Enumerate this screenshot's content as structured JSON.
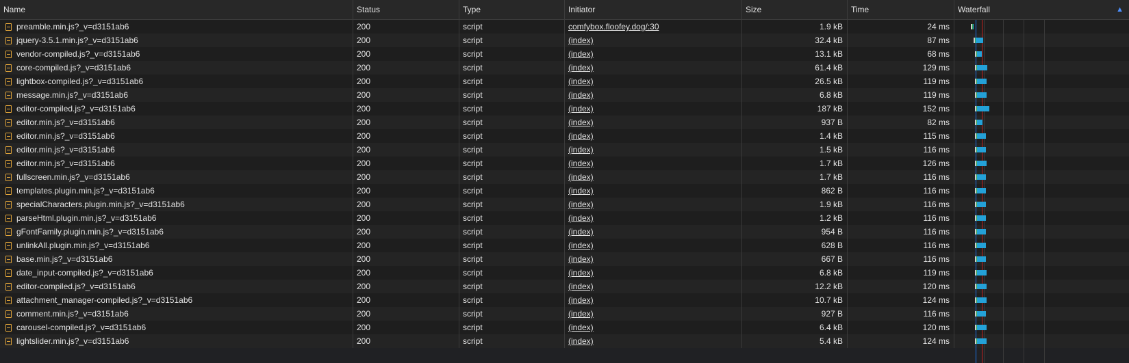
{
  "header": {
    "name": "Name",
    "status": "Status",
    "type": "Type",
    "initiator": "Initiator",
    "size": "Size",
    "time": "Time",
    "waterfall": "Waterfall",
    "sort_icon": "sort-up-icon"
  },
  "colors": {
    "background": "#202124",
    "file_icon": "#e3a63a",
    "dom_content_loaded_line": "#1a73e8",
    "load_line": "#c5221f",
    "download_bar": "#24a1d8"
  },
  "rows": [
    {
      "name": "preamble.min.js?_v=d3151ab6",
      "status": "200",
      "type": "script",
      "initiator": "comfybox.floofey.dog/:30",
      "size": "1.9 kB",
      "time": "24 ms",
      "wf_start": 0.16,
      "wf_end": 0.3
    },
    {
      "name": "jquery-3.5.1.min.js?_v=d3151ab6",
      "status": "200",
      "type": "script",
      "initiator": "(index)",
      "size": "32.4 kB",
      "time": "87 ms",
      "wf_start": 0.3,
      "wf_end": 0.78
    },
    {
      "name": "vendor-compiled.js?_v=d3151ab6",
      "status": "200",
      "type": "script",
      "initiator": "(index)",
      "size": "13.1 kB",
      "time": "68 ms",
      "wf_start": 0.34,
      "wf_end": 0.72
    },
    {
      "name": "core-compiled.js?_v=d3151ab6",
      "status": "200",
      "type": "script",
      "initiator": "(index)",
      "size": "61.4 kB",
      "time": "129 ms",
      "wf_start": 0.34,
      "wf_end": 1.0
    },
    {
      "name": "lightbox-compiled.js?_v=d3151ab6",
      "status": "200",
      "type": "script",
      "initiator": "(index)",
      "size": "26.5 kB",
      "time": "119 ms",
      "wf_start": 0.34,
      "wf_end": 0.96
    },
    {
      "name": "message.min.js?_v=d3151ab6",
      "status": "200",
      "type": "script",
      "initiator": "(index)",
      "size": "6.8 kB",
      "time": "119 ms",
      "wf_start": 0.34,
      "wf_end": 0.96
    },
    {
      "name": "editor-compiled.js?_v=d3151ab6",
      "status": "200",
      "type": "script",
      "initiator": "(index)",
      "size": "187 kB",
      "time": "152 ms",
      "wf_start": 0.34,
      "wf_end": 1.1
    },
    {
      "name": "editor.min.js?_v=d3151ab6",
      "status": "200",
      "type": "script",
      "initiator": "(index)",
      "size": "937 B",
      "time": "82 ms",
      "wf_start": 0.34,
      "wf_end": 0.76
    },
    {
      "name": "editor.min.js?_v=d3151ab6",
      "status": "200",
      "type": "script",
      "initiator": "(index)",
      "size": "1.4 kB",
      "time": "115 ms",
      "wf_start": 0.34,
      "wf_end": 0.94
    },
    {
      "name": "editor.min.js?_v=d3151ab6",
      "status": "200",
      "type": "script",
      "initiator": "(index)",
      "size": "1.5 kB",
      "time": "116 ms",
      "wf_start": 0.34,
      "wf_end": 0.94
    },
    {
      "name": "editor.min.js?_v=d3151ab6",
      "status": "200",
      "type": "script",
      "initiator": "(index)",
      "size": "1.7 kB",
      "time": "126 ms",
      "wf_start": 0.34,
      "wf_end": 0.98
    },
    {
      "name": "fullscreen.min.js?_v=d3151ab6",
      "status": "200",
      "type": "script",
      "initiator": "(index)",
      "size": "1.7 kB",
      "time": "116 ms",
      "wf_start": 0.34,
      "wf_end": 0.94
    },
    {
      "name": "templates.plugin.min.js?_v=d3151ab6",
      "status": "200",
      "type": "script",
      "initiator": "(index)",
      "size": "862 B",
      "time": "116 ms",
      "wf_start": 0.34,
      "wf_end": 0.94
    },
    {
      "name": "specialCharacters.plugin.min.js?_v=d3151ab6",
      "status": "200",
      "type": "script",
      "initiator": "(index)",
      "size": "1.9 kB",
      "time": "116 ms",
      "wf_start": 0.34,
      "wf_end": 0.94
    },
    {
      "name": "parseHtml.plugin.min.js?_v=d3151ab6",
      "status": "200",
      "type": "script",
      "initiator": "(index)",
      "size": "1.2 kB",
      "time": "116 ms",
      "wf_start": 0.34,
      "wf_end": 0.94
    },
    {
      "name": "gFontFamily.plugin.min.js?_v=d3151ab6",
      "status": "200",
      "type": "script",
      "initiator": "(index)",
      "size": "954 B",
      "time": "116 ms",
      "wf_start": 0.34,
      "wf_end": 0.94
    },
    {
      "name": "unlinkAll.plugin.min.js?_v=d3151ab6",
      "status": "200",
      "type": "script",
      "initiator": "(index)",
      "size": "628 B",
      "time": "116 ms",
      "wf_start": 0.34,
      "wf_end": 0.94
    },
    {
      "name": "base.min.js?_v=d3151ab6",
      "status": "200",
      "type": "script",
      "initiator": "(index)",
      "size": "667 B",
      "time": "116 ms",
      "wf_start": 0.34,
      "wf_end": 0.94
    },
    {
      "name": "date_input-compiled.js?_v=d3151ab6",
      "status": "200",
      "type": "script",
      "initiator": "(index)",
      "size": "6.8 kB",
      "time": "119 ms",
      "wf_start": 0.34,
      "wf_end": 0.96
    },
    {
      "name": "editor-compiled.js?_v=d3151ab6",
      "status": "200",
      "type": "script",
      "initiator": "(index)",
      "size": "12.2 kB",
      "time": "120 ms",
      "wf_start": 0.34,
      "wf_end": 0.96
    },
    {
      "name": "attachment_manager-compiled.js?_v=d3151ab6",
      "status": "200",
      "type": "script",
      "initiator": "(index)",
      "size": "10.7 kB",
      "time": "124 ms",
      "wf_start": 0.34,
      "wf_end": 0.98
    },
    {
      "name": "comment.min.js?_v=d3151ab6",
      "status": "200",
      "type": "script",
      "initiator": "(index)",
      "size": "927 B",
      "time": "116 ms",
      "wf_start": 0.34,
      "wf_end": 0.94
    },
    {
      "name": "carousel-compiled.js?_v=d3151ab6",
      "status": "200",
      "type": "script",
      "initiator": "(index)",
      "size": "6.4 kB",
      "time": "120 ms",
      "wf_start": 0.34,
      "wf_end": 0.96
    },
    {
      "name": "lightslider.min.js?_v=d3151ab6",
      "status": "200",
      "type": "script",
      "initiator": "(index)",
      "size": "5.4 kB",
      "time": "124 ms",
      "wf_start": 0.34,
      "wf_end": 0.98
    }
  ]
}
